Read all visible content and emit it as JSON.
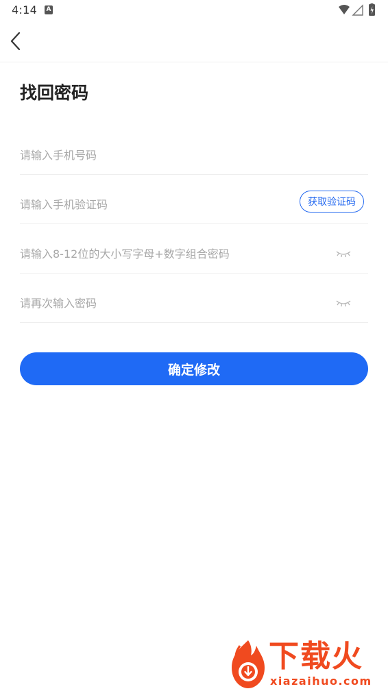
{
  "status_bar": {
    "time": "4:14",
    "notification_badge": "A",
    "icons": [
      "wifi-icon",
      "signal-icon",
      "battery-charging-icon"
    ]
  },
  "nav": {
    "back_icon": "chevron-left-icon"
  },
  "page": {
    "title": "找回密码"
  },
  "form": {
    "phone_placeholder": "请输入手机号码",
    "code_placeholder": "请输入手机验证码",
    "get_code_label": "获取验证码",
    "password_placeholder": "请输入8-12位的大小写字母+数字组合密码",
    "confirm_placeholder": "请再次输入密码",
    "eye_icon": "eye-closed-icon",
    "submit_label": "确定修改"
  },
  "watermark": {
    "text": "下载火",
    "url": "xiazaihuo.com"
  },
  "colors": {
    "accent": "#1f6af5",
    "watermark": "#f04a1f",
    "placeholder": "#a8a8a8",
    "divider": "#eeeeee"
  }
}
